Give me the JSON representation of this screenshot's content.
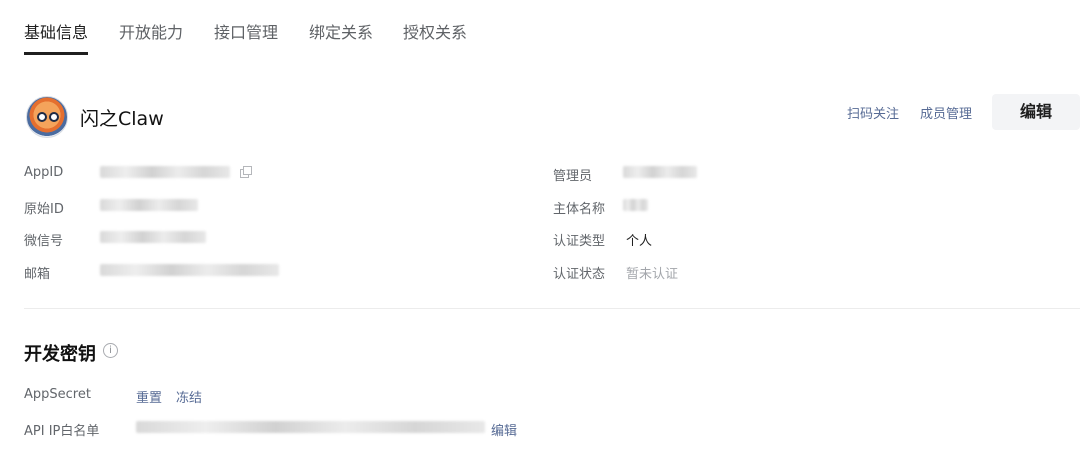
{
  "tabs": [
    {
      "label": "基础信息",
      "active": true
    },
    {
      "label": "开放能力",
      "active": false
    },
    {
      "label": "接口管理",
      "active": false
    },
    {
      "label": "绑定关系",
      "active": false
    },
    {
      "label": "授权关系",
      "active": false
    }
  ],
  "account": {
    "name": "闪之Claw",
    "scan_follow": "扫码关注",
    "member_manage": "成员管理",
    "edit": "编辑"
  },
  "left_fields": [
    {
      "label": "AppID"
    },
    {
      "label": "原始ID"
    },
    {
      "label": "微信号"
    },
    {
      "label": "邮箱"
    }
  ],
  "right_fields": [
    {
      "label": "管理员"
    },
    {
      "label": "主体名称"
    },
    {
      "label": "认证类型",
      "value": "个人"
    },
    {
      "label": "认证状态",
      "value": "暂未认证"
    }
  ],
  "dev": {
    "title": "开发密钥",
    "info_icon": "info-circle-icon",
    "secret_label": "AppSecret",
    "reset": "重置",
    "freeze": "冻结",
    "ip_label": "API IP白名单",
    "ip_edit": "编辑"
  },
  "colors": {
    "link": "#576b95",
    "text": "#1f1f1f",
    "muted": "#a3a6ab"
  }
}
